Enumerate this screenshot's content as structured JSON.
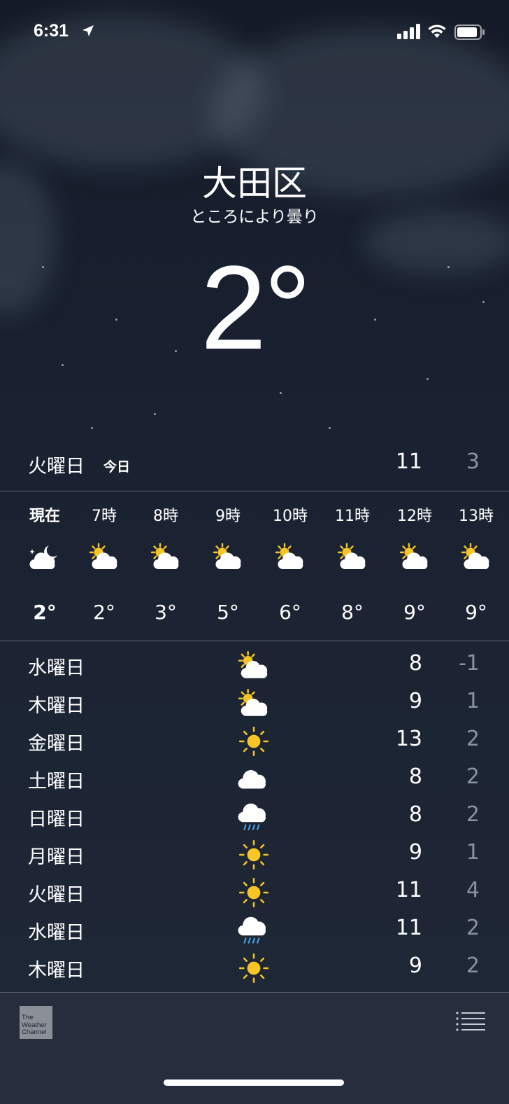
{
  "status_bar": {
    "time": "6:31"
  },
  "location": {
    "city": "大田区",
    "condition": "ところにより曇り",
    "temperature": "2°"
  },
  "today": {
    "day": "火曜日",
    "label": "今日",
    "high": "11",
    "low": "3"
  },
  "hourly": [
    {
      "label": "現在",
      "icon": "moon-cloud-icon",
      "temp": "2°"
    },
    {
      "label": "7時",
      "icon": "sun-cloud-icon",
      "temp": "2°"
    },
    {
      "label": "8時",
      "icon": "sun-cloud-icon",
      "temp": "3°"
    },
    {
      "label": "9時",
      "icon": "sun-cloud-icon",
      "temp": "5°"
    },
    {
      "label": "10時",
      "icon": "sun-cloud-icon",
      "temp": "6°"
    },
    {
      "label": "11時",
      "icon": "sun-cloud-icon",
      "temp": "8°"
    },
    {
      "label": "12時",
      "icon": "sun-cloud-icon",
      "temp": "9°"
    },
    {
      "label": "13時",
      "icon": "sun-cloud-icon",
      "temp": "9°"
    }
  ],
  "daily": [
    {
      "day": "水曜日",
      "icon": "sun-cloud-icon",
      "high": "8",
      "low": "-1"
    },
    {
      "day": "木曜日",
      "icon": "sun-cloud-icon",
      "high": "9",
      "low": "1"
    },
    {
      "day": "金曜日",
      "icon": "sun-icon",
      "high": "13",
      "low": "2"
    },
    {
      "day": "土曜日",
      "icon": "cloud-icon",
      "high": "8",
      "low": "2"
    },
    {
      "day": "日曜日",
      "icon": "rain-icon",
      "high": "8",
      "low": "2"
    },
    {
      "day": "月曜日",
      "icon": "sun-icon",
      "high": "9",
      "low": "1"
    },
    {
      "day": "火曜日",
      "icon": "sun-icon",
      "high": "11",
      "low": "4"
    },
    {
      "day": "水曜日",
      "icon": "rain-icon",
      "high": "11",
      "low": "2"
    },
    {
      "day": "木曜日",
      "icon": "sun-icon",
      "high": "9",
      "low": "2"
    }
  ],
  "footer": {
    "provider_logo": "The Weather Channel",
    "provider_logo_lines": [
      "The",
      "Weather",
      "Channel"
    ]
  },
  "colors": {
    "sun": "#f7c525",
    "cloud": "#ffffff",
    "rain": "#4aa3e8",
    "low_temp": "#8b929e"
  }
}
